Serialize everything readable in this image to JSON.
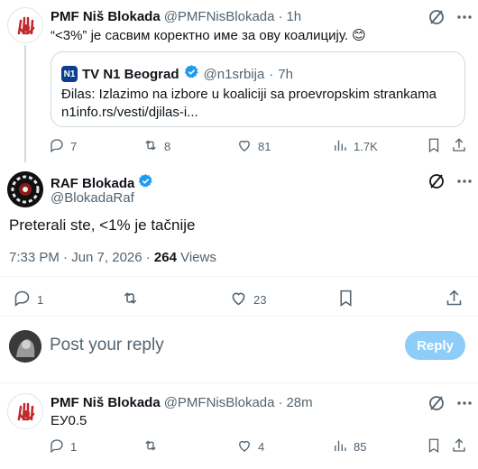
{
  "tweet1": {
    "display_name": "PMF Niš Blokada",
    "handle": "@PMFNisBlokada",
    "time": "1h",
    "text": "“<3%” је сасвим коректно име за ову коалицију. 😊",
    "quote": {
      "display_name": "TV N1 Beograd",
      "handle": "@n1srbija",
      "time": "7h",
      "text": "Đilas: Izlazimo na izbore u koaliciji sa proevropskim strankama",
      "link": "n1info.rs/vesti/djilas-i...",
      "logo_text": "N1"
    },
    "replies": "7",
    "reposts": "8",
    "likes": "81",
    "views": "1.7K"
  },
  "main_tweet": {
    "display_name": "RAF Blokada",
    "handle": "@BlokadaRaf",
    "text": "Preterali ste, <1% je tačnije",
    "timestamp": "7:33 PM · Jun 7, 2026 · ",
    "views_count": "264",
    "views_label": " Views",
    "replies": "1",
    "reposts": "",
    "likes": "23"
  },
  "composer": {
    "placeholder": "Post your reply",
    "reply_label": "Reply"
  },
  "tweet3": {
    "display_name": "PMF Niš Blokada",
    "handle": "@PMFNisBlokada",
    "time": "28m",
    "text": "EУ0.5",
    "replies": "1",
    "reposts": "",
    "likes": "4",
    "views": "85"
  },
  "colors": {
    "verified": "#1d9bf0",
    "muted": "#536471",
    "reply_button": "#8ecdf8"
  },
  "icons": [
    "grok-icon",
    "more-icon",
    "reply-icon",
    "repost-icon",
    "like-icon",
    "views-icon",
    "bookmark-icon",
    "share-icon",
    "verified-icon"
  ]
}
